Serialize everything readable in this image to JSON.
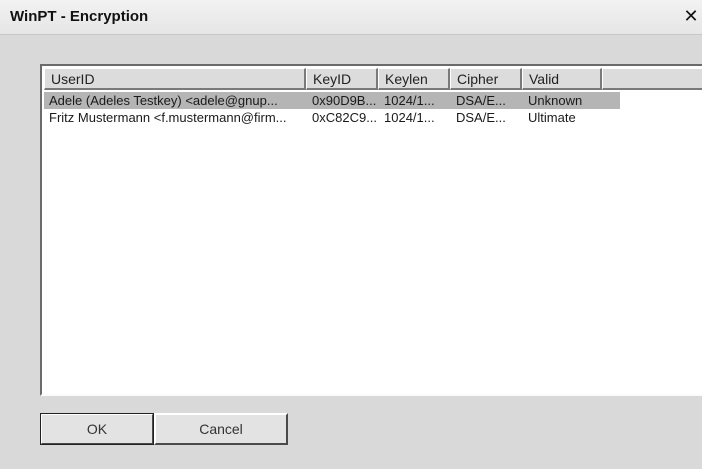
{
  "window": {
    "title": "WinPT - Encryption",
    "close_glyph": "✕"
  },
  "list": {
    "columns": [
      "UserID",
      "KeyID",
      "Keylen",
      "Cipher",
      "Valid"
    ],
    "rows": [
      {
        "userid": "Adele (Adeles Testkey) <adele@gnup...",
        "keyid": "0x90D9B...",
        "keylen": "1024/1...",
        "cipher": "DSA/E...",
        "valid": "Unknown",
        "selected": true
      },
      {
        "userid": "Fritz Mustermann <f.mustermann@firm...",
        "keyid": "0xC82C9...",
        "keylen": "1024/1...",
        "cipher": "DSA/E...",
        "valid": "Ultimate",
        "selected": false
      }
    ]
  },
  "buttons": {
    "ok": "OK",
    "cancel": "Cancel"
  }
}
